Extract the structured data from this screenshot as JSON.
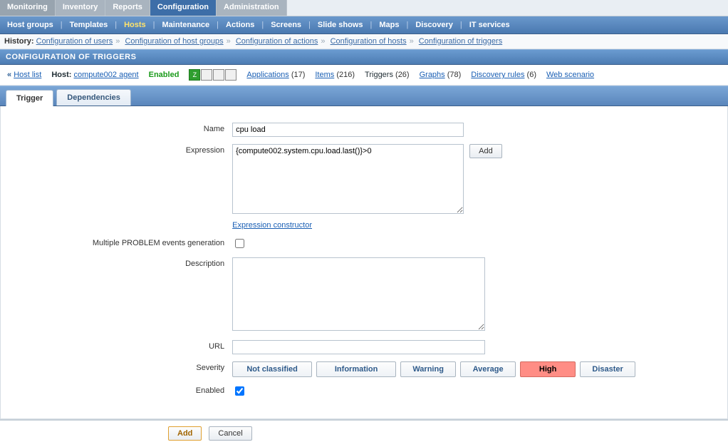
{
  "mainNav": {
    "items": [
      "Monitoring",
      "Inventory",
      "Reports",
      "Configuration",
      "Administration"
    ],
    "active": 3
  },
  "subNav": {
    "items": [
      "Host groups",
      "Templates",
      "Hosts",
      "Maintenance",
      "Actions",
      "Screens",
      "Slide shows",
      "Maps",
      "Discovery",
      "IT services"
    ],
    "active": 2
  },
  "history": {
    "label": "History:",
    "items": [
      "Configuration of users",
      "Configuration of host groups",
      "Configuration of actions",
      "Configuration of hosts",
      "Configuration of triggers"
    ]
  },
  "pageTitle": "CONFIGURATION OF TRIGGERS",
  "hostRow": {
    "backLink": "Host list",
    "hostLabel": "Host:",
    "hostName": "compute002 agent",
    "status": "Enabled",
    "links": [
      {
        "name": "Applications",
        "count": "(17)",
        "link": true
      },
      {
        "name": "Items",
        "count": "(216)",
        "link": true
      },
      {
        "name": "Triggers",
        "count": "(26)",
        "link": false
      },
      {
        "name": "Graphs",
        "count": "(78)",
        "link": true
      },
      {
        "name": "Discovery rules",
        "count": "(6)",
        "link": true
      },
      {
        "name": "Web scenario",
        "count": "",
        "link": true
      }
    ]
  },
  "tabs": {
    "items": [
      "Trigger",
      "Dependencies"
    ],
    "active": 0
  },
  "form": {
    "nameLabel": "Name",
    "nameValue": "cpu load",
    "exprLabel": "Expression",
    "exprValue": "{compute002.system.cpu.load.last()}>0",
    "addBtn": "Add",
    "exprConstructor": "Expression constructor",
    "multiLabel": "Multiple PROBLEM events generation",
    "multiChecked": false,
    "descLabel": "Description",
    "descValue": "",
    "urlLabel": "URL",
    "urlValue": "",
    "sevLabel": "Severity",
    "sevOptions": [
      "Not classified",
      "Information",
      "Warning",
      "Average",
      "High",
      "Disaster"
    ],
    "sevSelected": 4,
    "enabledLabel": "Enabled",
    "enabledChecked": true
  },
  "actions": {
    "add": "Add",
    "cancel": "Cancel"
  }
}
